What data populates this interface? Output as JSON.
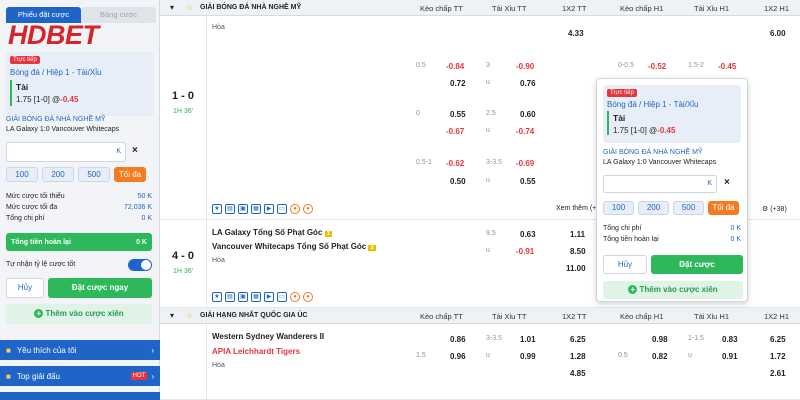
{
  "betslip": {
    "tab_active": "Phiếu đặt cược",
    "tab_inactive": "Bảng cược",
    "logo_main": "HDBET",
    "live_badge": "Trực tiếp",
    "market": "Bóng đá / Hiệp 1 - Tài/Xỉu",
    "selection": "Tài",
    "line": "1.75 [1-0] @",
    "odds": "-0.45",
    "league": "GIẢI BÓNG ĐÁ NHÀ NGHỀ MỸ",
    "match": "LA Galaxy 1:0 Vancouver Whitecaps",
    "input_k": "K",
    "clear": "×",
    "chips": [
      "100",
      "200",
      "500",
      "Tối đa"
    ],
    "min_label": "Mức cược tối thiểu",
    "min_value": "50 K",
    "max_label": "Mức cược tối đa",
    "max_value": "72,036 K",
    "total_label": "Tổng chi phí",
    "total_value": "0 K",
    "refund_label": "Tổng tiền hoàn lại",
    "refund_value": "0 K",
    "auto_accept": "Tự nhận tỷ lệ cược tốt",
    "cancel": "Hủy",
    "place": "Đặt cược ngay",
    "add_more": "Thêm vào cược xiên",
    "nav_favorites": "Yêu thích của tôi",
    "nav_top": "Top giải đấu",
    "hot_badge": "HOT"
  },
  "headers": {
    "league1": "GIẢI BÓNG ĐÁ NHÀ NGHỀ MỸ",
    "league2": "GIẢI HẠNG NHẤT QUỐC GIA ÚC",
    "cols": [
      "Kèo chấp TT",
      "Tài Xỉu TT",
      "1X2 TT",
      "Kèo chấp H1",
      "Tài Xỉu H1",
      "1X2 H1"
    ]
  },
  "matches": {
    "m1": {
      "score": "1 - 0",
      "time": "1H 36'",
      "draw": "Hòa",
      "top": {
        "x12": "4.33",
        "x12h1": "6.00"
      },
      "rows": [
        {
          "hc": "0.5",
          "o1": "-0.84",
          "hc2": "3",
          "o2": "-0.90",
          "hch1": "0-0.5",
          "oh1": "-0.52",
          "hch2": "1.5-2",
          "oh2": "-0.45"
        },
        {
          "o1": "0.72",
          "hc2": "u",
          "o2": "0.76"
        },
        {
          "hc": "0",
          "o1": "0.55",
          "hc2": "2.5",
          "o2": "0.60"
        },
        {
          "o1": "-0.67",
          "hc2": "u",
          "o2": "-0.74"
        },
        {
          "hc": "0.5-1",
          "o1": "-0.62",
          "hc2": "3-3.5",
          "o2": "-0.69"
        },
        {
          "o1": "0.50",
          "hc2": "u",
          "o2": "0.55"
        }
      ],
      "more": "Xem thêm (+",
      "more2": "(+38)"
    },
    "m2": {
      "score": "4 - 0",
      "time": "1H 36'",
      "home": "LA Galaxy Tổng Số Phạt Góc",
      "away": "Vancouver Whitecaps Tổng Số Phạt Góc",
      "draw": "Hòa",
      "hc2a": "9.5",
      "o2a": "0.63",
      "x1": "1.11",
      "hc2b": "u",
      "o2b": "-0.91",
      "x2": "8.50",
      "x3": "11.00"
    },
    "m3": {
      "home": "Western Sydney Wanderers II",
      "away": "APIA Leichhardt Tigers",
      "draw": "Hòa",
      "o1a": "0.86",
      "hc2a": "3-3.5",
      "o2a": "1.01",
      "x1": "6.25",
      "oh1a": "0.98",
      "hch2a": "1-1.5",
      "oh2a": "0.83",
      "xh1a": "6.25",
      "hc1b": "1.5",
      "o1b": "0.96",
      "hc2b": "u",
      "o2b": "0.99",
      "x2": "1.28",
      "hch1b": "0.5",
      "oh1b": "0.82",
      "hch2b": "u",
      "oh2b": "0.91",
      "xh1b": "1.72",
      "x3": "4.85",
      "xh1c": "2.61"
    }
  },
  "popup": {
    "live_badge": "Trực tiếp",
    "market": "Bóng đá / Hiệp 1 - Tài/Xỉu",
    "selection": "Tài",
    "line": "1.75 [1-0] @",
    "odds": "-0.45",
    "league": "GIẢI BÓNG ĐÁ NHÀ NGHỀ MỸ",
    "match": "LA Galaxy 1:0 Vancouver Whitecaps",
    "input_k": "K",
    "clear": "×",
    "chips": [
      "100",
      "200",
      "500",
      "Tối đa"
    ],
    "total_label": "Tổng chi phí",
    "total_value": "0 K",
    "refund_label": "Tổng tiền hoàn lại",
    "refund_value": "0 K",
    "cancel": "Hủy",
    "place": "Đặt cược",
    "add_more": "Thêm vào cược xiên"
  },
  "colors": {
    "brand_red": "#d8232a",
    "primary_blue": "#1f65c8",
    "green": "#2eb85c",
    "orange": "#f47b20"
  }
}
